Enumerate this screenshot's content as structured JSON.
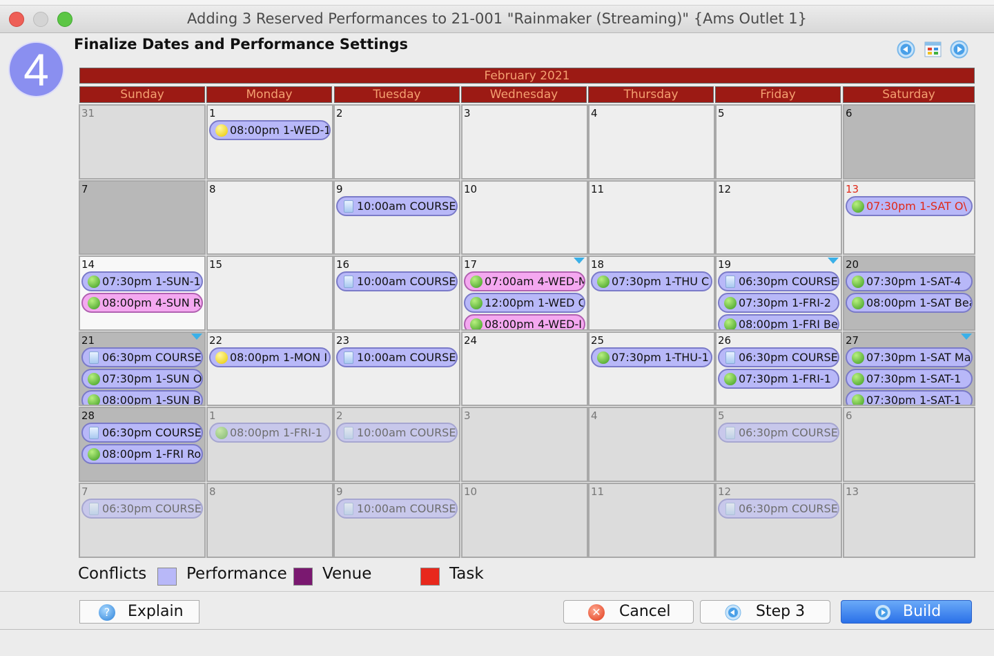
{
  "window": {
    "title": "Adding 3 Reserved Performances to 21-001 \"Rainmaker (Streaming)\" {Ams Outlet 1}"
  },
  "step": {
    "number": "4",
    "heading": "Finalize Dates and Performance Settings"
  },
  "nav": {
    "prev_icon": "left-arrow-circle-icon",
    "calendar_icon": "calendar-grid-icon",
    "next_icon": "right-arrow-circle-icon"
  },
  "calendar": {
    "month": "February 2021",
    "days_of_week": [
      "Sunday",
      "Monday",
      "Tuesday",
      "Wednesday",
      "Thursday",
      "Friday",
      "Saturday"
    ],
    "colors": {
      "header": "#9c1a14",
      "performance": "#b8b8f8",
      "pink": "#f4a8f0",
      "weekend": "#b8b8b8",
      "normal": "#eeeeee",
      "other_month": "#dcdcdc"
    },
    "weeks": [
      [
        {
          "day": "31",
          "bg": "other",
          "num_gray": true,
          "events": []
        },
        {
          "day": "1",
          "events": [
            {
              "icon": "yellow",
              "text": "08:00pm 1-WED-1"
            }
          ]
        },
        {
          "day": "2",
          "events": []
        },
        {
          "day": "3",
          "events": []
        },
        {
          "day": "4",
          "events": []
        },
        {
          "day": "5",
          "events": []
        },
        {
          "day": "6",
          "bg": "weekend",
          "events": []
        }
      ],
      [
        {
          "day": "7",
          "bg": "weekend",
          "events": []
        },
        {
          "day": "8",
          "events": []
        },
        {
          "day": "9",
          "events": [
            {
              "icon": "course",
              "text": "10:00am COURSE ."
            }
          ]
        },
        {
          "day": "10",
          "events": []
        },
        {
          "day": "11",
          "events": []
        },
        {
          "day": "12",
          "events": []
        },
        {
          "day": "13",
          "num_red": true,
          "events": [
            {
              "icon": "green",
              "text": "07:30pm 1-SAT O\\",
              "red": true
            }
          ]
        }
      ],
      [
        {
          "day": "14",
          "bg": "white",
          "events": [
            {
              "icon": "green",
              "text": "07:30pm 1-SUN-1"
            },
            {
              "icon": "green",
              "text": "08:00pm 4-SUN R",
              "pink": true
            }
          ]
        },
        {
          "day": "15",
          "events": []
        },
        {
          "day": "16",
          "events": [
            {
              "icon": "course",
              "text": "10:00am COURSE ."
            }
          ]
        },
        {
          "day": "17",
          "more": true,
          "events": [
            {
              "icon": "green",
              "text": "07:00am 4-WED-M",
              "pink": true
            },
            {
              "icon": "green",
              "text": "12:00pm 1-WED C"
            },
            {
              "icon": "green",
              "text": "08:00pm 4-WED-I",
              "pink": true
            }
          ]
        },
        {
          "day": "18",
          "events": [
            {
              "icon": "green",
              "text": "07:30pm 1-THU C"
            }
          ]
        },
        {
          "day": "19",
          "more": true,
          "events": [
            {
              "icon": "course",
              "text": "06:30pm COURSE"
            },
            {
              "icon": "green",
              "text": "07:30pm 1-FRI-2"
            },
            {
              "icon": "green",
              "text": "08:00pm 1-FRI Be"
            }
          ]
        },
        {
          "day": "20",
          "bg": "weekend",
          "events": [
            {
              "icon": "green",
              "text": "07:30pm 1-SAT-4"
            },
            {
              "icon": "green",
              "text": "08:00pm 1-SAT Bea"
            }
          ]
        }
      ],
      [
        {
          "day": "21",
          "bg": "weekend",
          "more": true,
          "events": [
            {
              "icon": "course",
              "text": "06:30pm COURSE"
            },
            {
              "icon": "green",
              "text": "07:30pm 1-SUN O"
            },
            {
              "icon": "green",
              "text": "08:00pm 1-SUN B"
            }
          ]
        },
        {
          "day": "22",
          "events": [
            {
              "icon": "yellow",
              "text": "08:00pm 1-MON I"
            }
          ]
        },
        {
          "day": "23",
          "events": [
            {
              "icon": "course",
              "text": "10:00am COURSE ."
            }
          ]
        },
        {
          "day": "24",
          "events": []
        },
        {
          "day": "25",
          "events": [
            {
              "icon": "green",
              "text": "07:30pm 1-THU-1"
            }
          ]
        },
        {
          "day": "26",
          "events": [
            {
              "icon": "course",
              "text": "06:30pm COURSE"
            },
            {
              "icon": "green",
              "text": "07:30pm 1-FRI-1"
            }
          ]
        },
        {
          "day": "27",
          "bg": "weekend",
          "more": true,
          "events": [
            {
              "icon": "green",
              "text": "07:30pm 1-SAT Ma"
            },
            {
              "icon": "green",
              "text": "07:30pm 1-SAT-1"
            },
            {
              "icon": "green",
              "text": "07:30pm 1-SAT-1"
            }
          ]
        }
      ],
      [
        {
          "day": "28",
          "bg": "weekend",
          "events": [
            {
              "icon": "course",
              "text": "06:30pm COURSE"
            },
            {
              "icon": "green",
              "text": "08:00pm 1-FRI Ro"
            }
          ]
        },
        {
          "day": "1",
          "bg": "other",
          "faded": true,
          "events": [
            {
              "icon": "green",
              "text": "08:00pm 1-FRI-1"
            }
          ]
        },
        {
          "day": "2",
          "bg": "other",
          "faded": true,
          "events": [
            {
              "icon": "course",
              "text": "10:00am COURSE ."
            }
          ]
        },
        {
          "day": "3",
          "bg": "other",
          "faded": true,
          "events": []
        },
        {
          "day": "4",
          "bg": "other",
          "faded": true,
          "events": []
        },
        {
          "day": "5",
          "bg": "other",
          "faded": true,
          "events": [
            {
              "icon": "course",
              "text": "06:30pm COURSE"
            }
          ]
        },
        {
          "day": "6",
          "bg": "other",
          "faded": true,
          "events": []
        }
      ],
      [
        {
          "day": "7",
          "bg": "other",
          "faded": true,
          "events": [
            {
              "icon": "course",
              "text": "06:30pm COURSE"
            }
          ]
        },
        {
          "day": "8",
          "bg": "other",
          "faded": true,
          "events": []
        },
        {
          "day": "9",
          "bg": "other",
          "faded": true,
          "events": [
            {
              "icon": "course",
              "text": "10:00am COURSE ."
            }
          ]
        },
        {
          "day": "10",
          "bg": "other",
          "faded": true,
          "events": []
        },
        {
          "day": "11",
          "bg": "other",
          "faded": true,
          "events": []
        },
        {
          "day": "12",
          "bg": "other",
          "faded": true,
          "events": [
            {
              "icon": "course",
              "text": "06:30pm COURSE"
            }
          ]
        },
        {
          "day": "13",
          "bg": "other",
          "faded": true,
          "events": []
        }
      ]
    ]
  },
  "legend": {
    "conflicts": "Conflicts",
    "performance": "Performance",
    "venue": "Venue",
    "task": "Task",
    "colors": {
      "performance": "#b8b8f8",
      "venue": "#7a1870",
      "task": "#e8281c"
    }
  },
  "buttons": {
    "explain": "Explain",
    "cancel": "Cancel",
    "step3": "Step 3",
    "build": "Build"
  }
}
